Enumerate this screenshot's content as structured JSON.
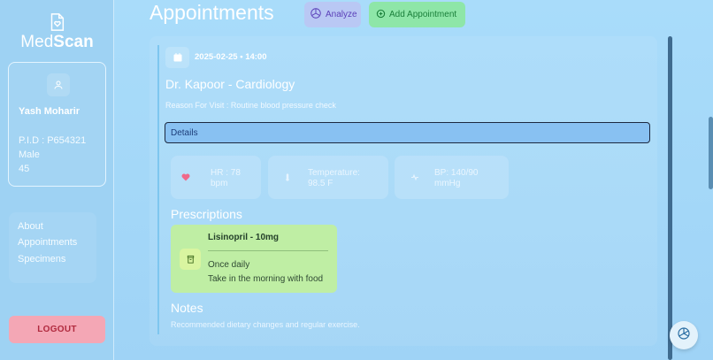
{
  "app": {
    "logo_light": "Med",
    "logo_bold": "Scan"
  },
  "patient": {
    "name": "Yash Moharir",
    "pid": "P.I.D : P654321",
    "gender": "Male",
    "age": "45"
  },
  "sidebar": {
    "items": [
      {
        "label": "About"
      },
      {
        "label": "Appointments"
      },
      {
        "label": "Specimens"
      }
    ],
    "logout_label": "LOGOUT"
  },
  "header": {
    "title": "Appointments",
    "analyze_label": "Analyze",
    "add_label": "Add Appointment"
  },
  "appointment": {
    "datetime": "2025-02-25 • 14:00",
    "doctor": "Dr. Kapoor - Cardiology",
    "reason": "Reason For Visit : Routine blood pressure check",
    "details_label": "Details",
    "vitals": [
      {
        "label": "HR : 78",
        "value": "bpm",
        "icon": "heart-icon"
      },
      {
        "label": "Temperature:",
        "value": "98.5 F",
        "icon": "thermometer-icon"
      },
      {
        "label": "BP: 140/90",
        "value": "mmHg",
        "icon": "blood-pressure-icon"
      }
    ],
    "prescriptions_title": "Prescriptions",
    "prescription": {
      "name": "Lisinopril - 10mg",
      "frequency": "Once daily",
      "instructions": "Take in the morning with food"
    },
    "notes_title": "Notes",
    "notes": "Recommended dietary changes and regular exercise."
  },
  "colors": {
    "accent_green": "#8ee6a8",
    "accent_purple": "#b9c8f4",
    "logout": "#f4a7b5",
    "details_bar": "#88c1f2"
  }
}
